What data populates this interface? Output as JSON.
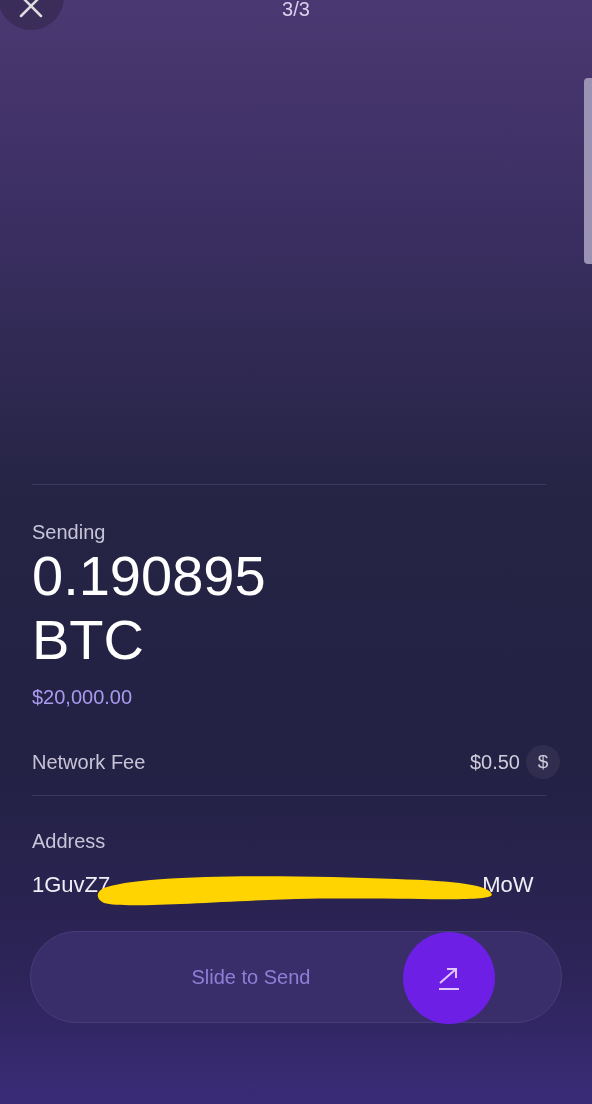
{
  "header": {
    "step": "3/3"
  },
  "sending": {
    "label": "Sending",
    "amount": "0.190895",
    "unit": "BTC",
    "fiat": "$20,000.00"
  },
  "network_fee": {
    "label": "Network Fee",
    "value": "$0.50",
    "currency_toggle": "$"
  },
  "address": {
    "label": "Address",
    "visible_start": "1GuvZ7",
    "visible_end": "MoW",
    "redacted": true
  },
  "slider": {
    "label": "Slide to Send",
    "level": 0.85
  }
}
